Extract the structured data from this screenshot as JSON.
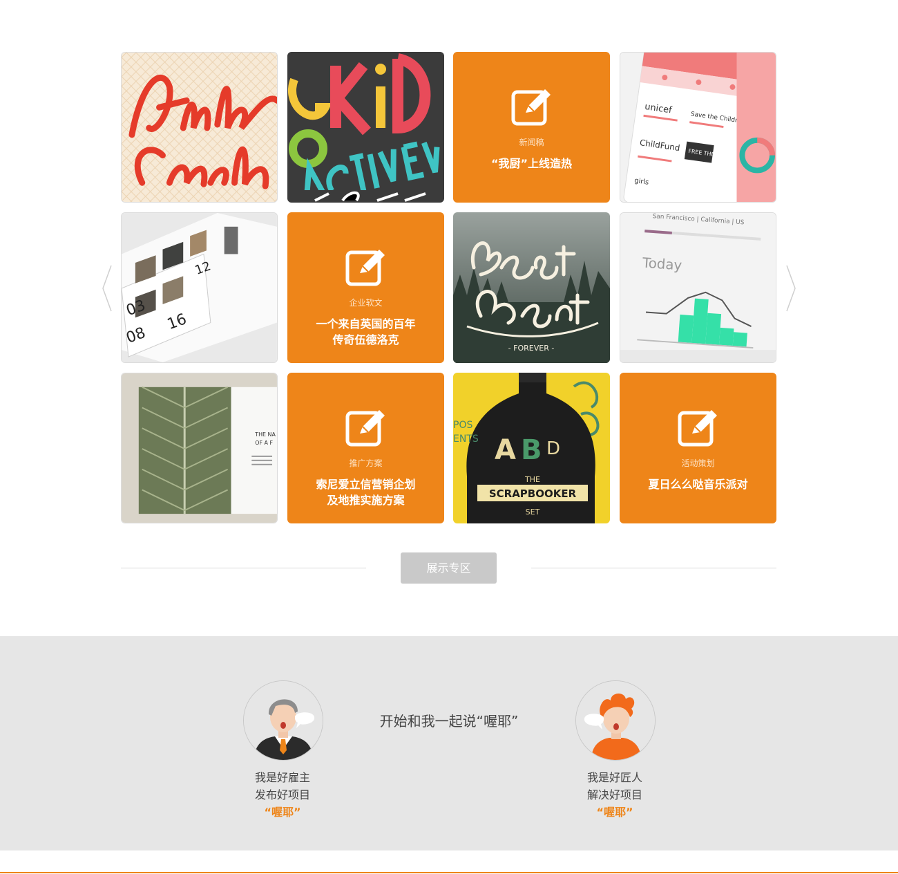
{
  "colors": {
    "accent": "#ee8519",
    "band": "#e6e6e6",
    "button": "#c9c9c9"
  },
  "gallery": {
    "row1": {
      "tile1_image": "script lettering artwork",
      "tile2_image": "GoKid activewear typography",
      "tile3": {
        "category": "新闻稿",
        "title": "“我厨”上线造热",
        "icon": "edit-icon"
      },
      "tile4_image": "charity app interface"
    },
    "row2": {
      "tile1_image": "magazine spread",
      "tile2": {
        "category": "企业软文",
        "title_line1": "一个来自英国的百年",
        "title_line2": "传奇伍德洛克",
        "icon": "edit-icon"
      },
      "tile3_image": "Best Coast lettering",
      "tile4_image": "weather app interface"
    },
    "row3": {
      "tile1_image": "leaf book spread",
      "tile2": {
        "category": "推广方案",
        "title_line1": "索尼爱立信营销企划",
        "title_line2": "及地推实施方案",
        "icon": "edit-icon"
      },
      "tile3_image": "ABC scrapbooker poster",
      "tile4": {
        "category": "活动策划",
        "title": "夏日么么哒音乐派对",
        "icon": "edit-icon"
      }
    }
  },
  "showcase_button": "展示专区",
  "slogan": "开始和我一起说“喔耶”",
  "employer": {
    "line1": "我是好雇主",
    "line2": "发布好项目",
    "accent": "“喔耶”"
  },
  "craftsman": {
    "line1": "我是好匠人",
    "line2": "解决好项目",
    "accent": "“喔耶”"
  }
}
